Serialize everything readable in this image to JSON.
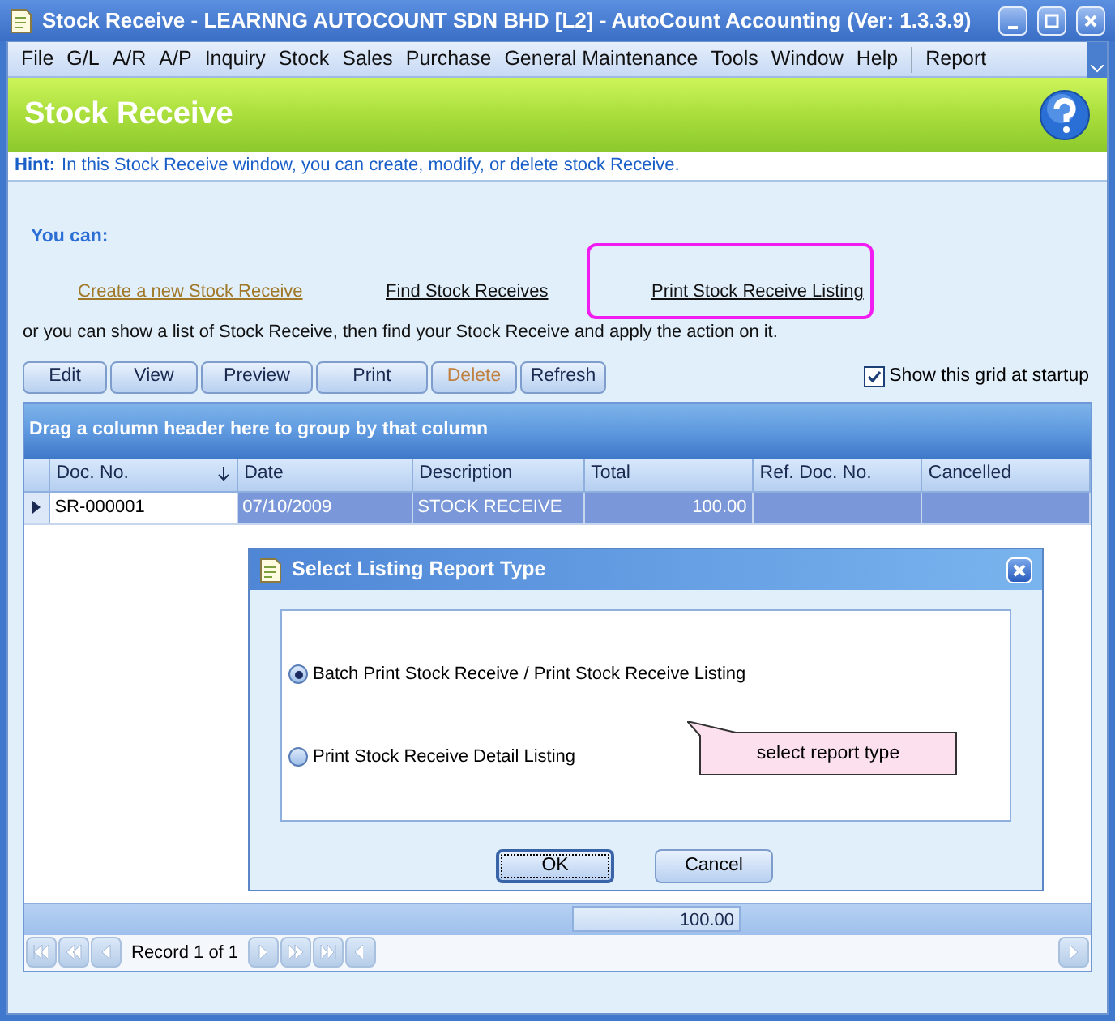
{
  "window": {
    "title": "Stock Receive - LEARNNG AUTOCOUNT SDN BHD [L2] - AutoCount Accounting (Ver: 1.3.3.9)"
  },
  "menu": [
    "File",
    "G/L",
    "A/R",
    "A/P",
    "Inquiry",
    "Stock",
    "Sales",
    "Purchase",
    "General Maintenance",
    "Tools",
    "Window",
    "Help",
    "Report"
  ],
  "header": {
    "title": "Stock Receive"
  },
  "hint": {
    "label": "Hint:",
    "text": "In this Stock Receive window, you can create, modify, or delete stock Receive."
  },
  "you_can": "You can:",
  "links": [
    {
      "label": "Create a new Stock Receive",
      "visited": true,
      "highlighted": false
    },
    {
      "label": "Find Stock Receives",
      "visited": false,
      "highlighted": false
    },
    {
      "label": "Print Stock Receive Listing",
      "visited": false,
      "highlighted": true
    }
  ],
  "sentence": "or you can show a list of Stock Receive, then find your Stock Receive and apply the action on it.",
  "toolbar": [
    {
      "label": "Edit",
      "disabled": false
    },
    {
      "label": "View",
      "disabled": false
    },
    {
      "label": "Preview",
      "disabled": false
    },
    {
      "label": "Print",
      "disabled": false
    },
    {
      "label": "Delete",
      "disabled": true
    },
    {
      "label": "Refresh",
      "disabled": false
    }
  ],
  "show_grid": {
    "label": "Show this grid at startup",
    "checked": true
  },
  "grid": {
    "group_hint": "Drag a column header here to group by that column",
    "columns": [
      {
        "label": "Doc. No.",
        "sorted": true
      },
      {
        "label": "Date",
        "sorted": false
      },
      {
        "label": "Description",
        "sorted": false
      },
      {
        "label": "Total",
        "sorted": false
      },
      {
        "label": "Ref. Doc. No.",
        "sorted": false
      },
      {
        "label": "Cancelled",
        "sorted": false
      }
    ],
    "rows": [
      {
        "selected": true,
        "cells": [
          "SR-000001",
          "07/10/2009",
          "STOCK RECEIVE",
          "100.00",
          "",
          ""
        ]
      }
    ],
    "total": "100.00",
    "record": "Record 1 of 1"
  },
  "dialog": {
    "title": "Select Listing Report Type",
    "options": [
      {
        "label": "Batch Print Stock Receive / Print Stock Receive Listing",
        "selected": true
      },
      {
        "label": "Print Stock Receive Detail Listing",
        "selected": false
      }
    ],
    "callout": "select report type",
    "buttons": [
      {
        "label": "OK",
        "default": true
      },
      {
        "label": "Cancel",
        "default": false
      }
    ]
  }
}
